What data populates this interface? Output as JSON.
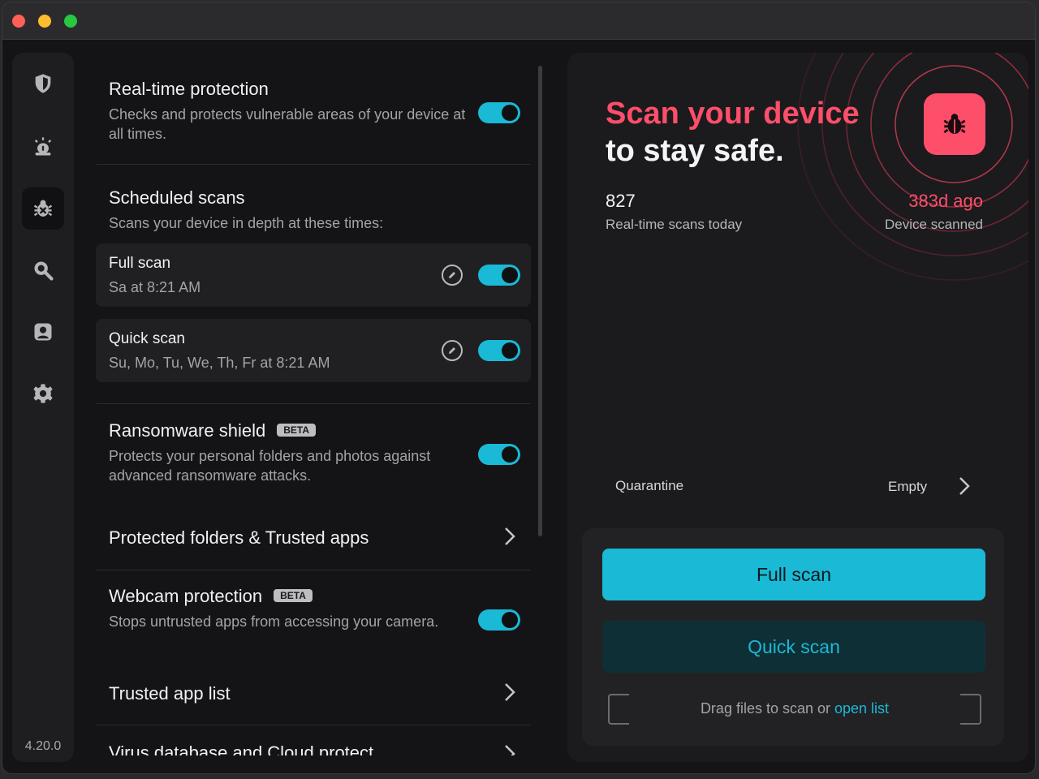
{
  "app": {
    "version": "4.20.0"
  },
  "sidebar": {
    "items": [
      {
        "icon": "shield-icon"
      },
      {
        "icon": "alarm-icon"
      },
      {
        "icon": "bug-icon",
        "active": true
      },
      {
        "icon": "search-icon"
      },
      {
        "icon": "user-icon"
      },
      {
        "icon": "gear-icon"
      }
    ]
  },
  "settings": {
    "realtime": {
      "title": "Real-time protection",
      "desc": "Checks and protects vulnerable areas of your device at all times.",
      "enabled": true
    },
    "scheduled": {
      "title": "Scheduled scans",
      "desc": "Scans your device in depth at these times:",
      "items": [
        {
          "title": "Full scan",
          "schedule": "Sa at 8:21 AM",
          "enabled": true
        },
        {
          "title": "Quick scan",
          "schedule": "Su, Mo, Tu, We, Th, Fr at 8:21 AM",
          "enabled": true
        }
      ]
    },
    "ransomware": {
      "title": "Ransomware shield",
      "badge": "BETA",
      "desc": "Protects your personal folders and photos against advanced ransomware attacks.",
      "enabled": true
    },
    "protected_folders": {
      "title": "Protected folders & Trusted apps"
    },
    "webcam": {
      "title": "Webcam protection",
      "badge": "BETA",
      "desc": "Stops untrusted apps from accessing your camera.",
      "enabled": true
    },
    "trusted_list": {
      "title": "Trusted app list"
    },
    "virus_db": {
      "title": "Virus database and Cloud protect"
    }
  },
  "panel": {
    "headline_accent": "Scan your device",
    "headline_rest": "to stay safe.",
    "stats": {
      "realtime_count": "827",
      "realtime_label": "Real-time scans today",
      "last_scan": "383d ago",
      "last_scan_label": "Device scanned"
    },
    "quarantine": {
      "label": "Quarantine",
      "value": "Empty"
    },
    "buttons": {
      "full": "Full scan",
      "quick": "Quick scan"
    },
    "drop": {
      "text": "Drag files to scan or ",
      "link": "open list"
    }
  },
  "colors": {
    "accent": "#1ab9d6",
    "alert": "#fd4e6a",
    "bg": "#141416"
  }
}
